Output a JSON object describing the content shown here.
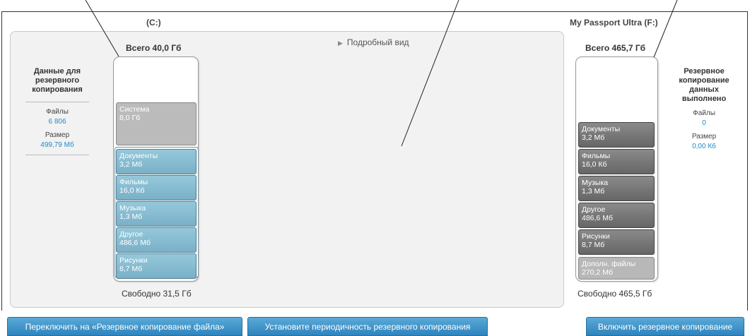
{
  "drives": {
    "source": {
      "title": "(C:)",
      "total": "Всего 40,0 Гб",
      "free": "Свободно 31,5 Гб",
      "system": {
        "name": "Система",
        "size": "8,0 Гб"
      },
      "categories": [
        {
          "name": "Документы",
          "size": "3,2 Мб"
        },
        {
          "name": "Фильмы",
          "size": "16,0 Кб"
        },
        {
          "name": "Музыка",
          "size": "1,3 Мб"
        },
        {
          "name": "Другое",
          "size": "486,6 Мб"
        },
        {
          "name": "Рисунки",
          "size": "8,7 Мб"
        }
      ],
      "stats": {
        "heading": "Данные для резервного копирования",
        "files_label": "Файлы",
        "files_value": "6 806",
        "size_label": "Размер",
        "size_value": "499,79 Мб"
      }
    },
    "target": {
      "title": "My Passport Ultra (F:)",
      "total": "Всего 465,7 Гб",
      "free": "Свободно 465,5 Гб",
      "categories": [
        {
          "name": "Документы",
          "size": "3,2 Мб"
        },
        {
          "name": "Фильмы",
          "size": "16,0 Кб"
        },
        {
          "name": "Музыка",
          "size": "1,3 Мб"
        },
        {
          "name": "Другое",
          "size": "486,6 Мб"
        },
        {
          "name": "Рисунки",
          "size": "8,7 Мб"
        }
      ],
      "extra": {
        "name": "Дополн. файлы",
        "size": "270,2 Мб"
      },
      "stats": {
        "heading": "Резервное копирование данных выполнено",
        "files_label": "Файлы",
        "files_value": "0",
        "size_label": "Размер",
        "size_value": "0,00 Кб"
      }
    }
  },
  "detail_view": "Подробный вид",
  "buttons": {
    "switch_mode": "Переключить на «Резервное копирование файла»",
    "schedule": "Установите периодичность резервного копирования",
    "enable_backup": "Включить резервное копирование"
  },
  "colors": {
    "accent_button": "#2f84bd",
    "value_text": "#1a8fc6",
    "source_category": "#79b0c8",
    "target_category": "#666666"
  }
}
